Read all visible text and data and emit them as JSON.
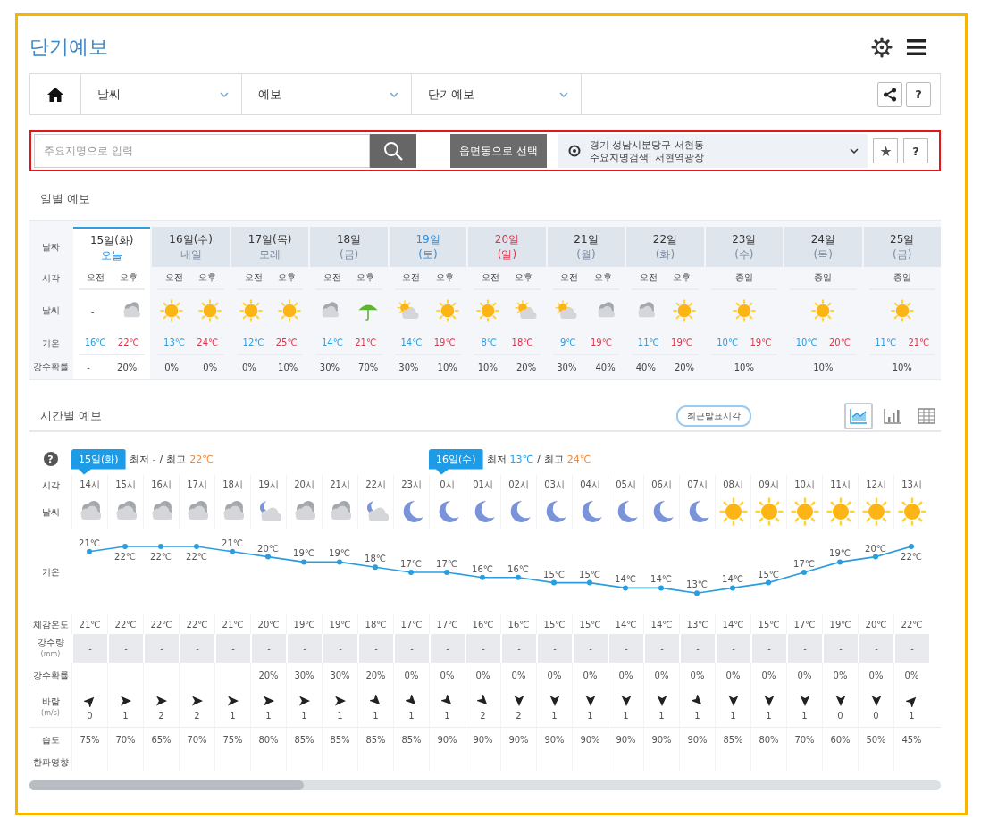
{
  "page": {
    "title": "단기예보"
  },
  "nav": {
    "items": [
      {
        "label": "날씨"
      },
      {
        "label": "예보"
      },
      {
        "label": "단기예보"
      }
    ],
    "help": "?"
  },
  "search": {
    "placeholder": "주요지명으로 입력",
    "region_button": "읍면동으로 선택",
    "location": {
      "address": "경기 성남시분당구 서현동",
      "landmark": "주요지명검색: 서현역광장"
    },
    "help": "?"
  },
  "daily": {
    "title": "일별 예보",
    "row_labels": [
      "날짜",
      "시각",
      "날씨",
      "기온",
      "강수확률"
    ],
    "days": [
      {
        "date": "15일(화)",
        "sub": "오늘",
        "kind": "weekday",
        "selected": true,
        "low": "16℃",
        "high": "22℃",
        "slots": [
          {
            "period": "오전",
            "weather_text": "-",
            "pop": "-"
          },
          {
            "period": "오후",
            "kind": "cloud",
            "pop": "20%"
          }
        ]
      },
      {
        "date": "16일(수)",
        "sub": "내일",
        "kind": "weekday",
        "selected": false,
        "low": "13℃",
        "high": "24℃",
        "slots": [
          {
            "period": "오전",
            "kind": "sun",
            "pop": "0%"
          },
          {
            "period": "오후",
            "kind": "sun",
            "pop": "0%"
          }
        ]
      },
      {
        "date": "17일(목)",
        "sub": "모레",
        "kind": "weekday",
        "selected": false,
        "low": "12℃",
        "high": "25℃",
        "slots": [
          {
            "period": "오전",
            "kind": "sun",
            "pop": "0%"
          },
          {
            "period": "오후",
            "kind": "sun",
            "pop": "10%"
          }
        ]
      },
      {
        "date": "18일",
        "sub": "(금)",
        "kind": "weekday",
        "selected": false,
        "low": "14℃",
        "high": "21℃",
        "slots": [
          {
            "period": "오전",
            "kind": "cloud",
            "pop": "30%"
          },
          {
            "period": "오후",
            "kind": "rain",
            "pop": "70%"
          }
        ]
      },
      {
        "date": "19일",
        "sub": "(토)",
        "kind": "saturday",
        "selected": false,
        "low": "14℃",
        "high": "19℃",
        "slots": [
          {
            "period": "오전",
            "kind": "sun_cloud",
            "pop": "30%"
          },
          {
            "period": "오후",
            "kind": "sun",
            "pop": "10%"
          }
        ]
      },
      {
        "date": "20일",
        "sub": "(일)",
        "kind": "sunday",
        "selected": false,
        "low": "8℃",
        "high": "18℃",
        "slots": [
          {
            "period": "오전",
            "kind": "sun",
            "pop": "10%"
          },
          {
            "period": "오후",
            "kind": "sun_cloud",
            "pop": "20%"
          }
        ]
      },
      {
        "date": "21일",
        "sub": "(월)",
        "kind": "weekday",
        "selected": false,
        "low": "9℃",
        "high": "19℃",
        "slots": [
          {
            "period": "오전",
            "kind": "sun_cloud",
            "pop": "30%"
          },
          {
            "period": "오후",
            "kind": "cloud",
            "pop": "40%"
          }
        ]
      },
      {
        "date": "22일",
        "sub": "(화)",
        "kind": "weekday",
        "selected": false,
        "low": "11℃",
        "high": "19℃",
        "slots": [
          {
            "period": "오전",
            "kind": "cloud",
            "pop": "40%"
          },
          {
            "period": "오후",
            "kind": "sun",
            "pop": "20%"
          }
        ]
      },
      {
        "date": "23일",
        "sub": "(수)",
        "kind": "weekday",
        "selected": false,
        "low": "10℃",
        "high": "19℃",
        "slots": [
          {
            "period": "종일",
            "kind": "sun",
            "pop": "10%"
          }
        ]
      },
      {
        "date": "24일",
        "sub": "(목)",
        "kind": "weekday",
        "selected": false,
        "low": "10℃",
        "high": "20℃",
        "slots": [
          {
            "period": "종일",
            "kind": "sun",
            "pop": "10%"
          }
        ]
      },
      {
        "date": "25일",
        "sub": "(금)",
        "kind": "weekday",
        "selected": false,
        "low": "11℃",
        "high": "21℃",
        "slots": [
          {
            "period": "종일",
            "kind": "sun",
            "pop": "10%"
          }
        ]
      }
    ]
  },
  "hourly": {
    "title": "시간별 예보",
    "issued_button": "최근발표시각",
    "views": [
      {
        "kind": "line",
        "selected": true
      },
      {
        "kind": "bar",
        "selected": false
      },
      {
        "kind": "table",
        "selected": false
      }
    ],
    "help": "?",
    "row_labels": [
      {
        "text": "시각"
      },
      {
        "text": "날씨"
      },
      {
        "text": "기온"
      },
      {
        "text": "체감온도"
      },
      {
        "text": "강수량",
        "unit": "(mm)"
      },
      {
        "text": "강수확률"
      },
      {
        "text": "바람",
        "unit": "(m/s)"
      },
      {
        "text": "습도"
      },
      {
        "text": "한파영향"
      }
    ],
    "columns": [
      {
        "time": "14시",
        "kind": "cloud",
        "temp": "21℃",
        "feels": "21℃",
        "rain": "-",
        "wind": {
          "kind": "ne",
          "speed": "0"
        },
        "humidity": "75%",
        "day_badge": {
          "label": "15일(화)",
          "min_label": "최저",
          "min": "-",
          "separator": "/",
          "max_label": "최고",
          "max": "22℃"
        }
      },
      {
        "time": "15시",
        "kind": "cloud",
        "temp": "22℃",
        "feels": "22℃",
        "rain": "-",
        "wind": {
          "kind": "e",
          "speed": "1"
        },
        "humidity": "70%"
      },
      {
        "time": "16시",
        "kind": "cloud",
        "temp": "22℃",
        "feels": "22℃",
        "rain": "-",
        "wind": {
          "kind": "e",
          "speed": "2"
        },
        "humidity": "65%"
      },
      {
        "time": "17시",
        "kind": "cloud",
        "temp": "22℃",
        "feels": "22℃",
        "rain": "-",
        "wind": {
          "kind": "e",
          "speed": "2"
        },
        "humidity": "70%"
      },
      {
        "time": "18시",
        "kind": "cloud",
        "temp": "21℃",
        "feels": "21℃",
        "rain": "-",
        "wind": {
          "kind": "e",
          "speed": "1"
        },
        "humidity": "75%"
      },
      {
        "time": "19시",
        "kind": "moon_cloud",
        "temp": "20℃",
        "feels": "20℃",
        "rain": "-",
        "pop": "20%",
        "wind": {
          "kind": "e",
          "speed": "1"
        },
        "humidity": "80%"
      },
      {
        "time": "20시",
        "kind": "cloud",
        "temp": "19℃",
        "feels": "19℃",
        "rain": "-",
        "pop": "30%",
        "wind": {
          "kind": "e",
          "speed": "1"
        },
        "humidity": "85%"
      },
      {
        "time": "21시",
        "kind": "cloud",
        "temp": "19℃",
        "feels": "19℃",
        "rain": "-",
        "pop": "30%",
        "wind": {
          "kind": "e",
          "speed": "1"
        },
        "humidity": "85%"
      },
      {
        "time": "22시",
        "kind": "moon_cloud",
        "temp": "18℃",
        "feels": "18℃",
        "rain": "-",
        "pop": "20%",
        "wind": {
          "kind": "se",
          "speed": "1"
        },
        "humidity": "85%"
      },
      {
        "time": "23시",
        "kind": "moon",
        "temp": "17℃",
        "feels": "17℃",
        "rain": "-",
        "pop": "0%",
        "wind": {
          "kind": "se",
          "speed": "1"
        },
        "humidity": "85%"
      },
      {
        "time": "0시",
        "kind": "moon",
        "temp": "17℃",
        "feels": "17℃",
        "rain": "-",
        "pop": "0%",
        "wind": {
          "kind": "se",
          "speed": "1"
        },
        "humidity": "90%",
        "day_badge": {
          "label": "16일(수)",
          "min_label": "최저",
          "min": "13℃",
          "separator": "/",
          "max_label": "최고",
          "max": "24℃"
        }
      },
      {
        "time": "01시",
        "kind": "moon",
        "temp": "16℃",
        "feels": "16℃",
        "rain": "-",
        "pop": "0%",
        "wind": {
          "kind": "se",
          "speed": "2"
        },
        "humidity": "90%"
      },
      {
        "time": "02시",
        "kind": "moon",
        "temp": "16℃",
        "feels": "16℃",
        "rain": "-",
        "pop": "0%",
        "wind": {
          "kind": "s",
          "speed": "2"
        },
        "humidity": "90%"
      },
      {
        "time": "03시",
        "kind": "moon",
        "temp": "15℃",
        "feels": "15℃",
        "rain": "-",
        "pop": "0%",
        "wind": {
          "kind": "s",
          "speed": "1"
        },
        "humidity": "90%"
      },
      {
        "time": "04시",
        "kind": "moon",
        "temp": "15℃",
        "feels": "15℃",
        "rain": "-",
        "pop": "0%",
        "wind": {
          "kind": "s",
          "speed": "1"
        },
        "humidity": "90%"
      },
      {
        "time": "05시",
        "kind": "moon",
        "temp": "14℃",
        "feels": "14℃",
        "rain": "-",
        "pop": "0%",
        "wind": {
          "kind": "s",
          "speed": "1"
        },
        "humidity": "90%"
      },
      {
        "time": "06시",
        "kind": "moon",
        "temp": "14℃",
        "feels": "14℃",
        "rain": "-",
        "pop": "0%",
        "wind": {
          "kind": "s",
          "speed": "1"
        },
        "humidity": "90%"
      },
      {
        "time": "07시",
        "kind": "moon",
        "temp": "13℃",
        "feels": "13℃",
        "rain": "-",
        "pop": "0%",
        "wind": {
          "kind": "se",
          "speed": "1"
        },
        "humidity": "90%"
      },
      {
        "time": "08시",
        "kind": "sun",
        "temp": "14℃",
        "feels": "14℃",
        "rain": "-",
        "pop": "0%",
        "wind": {
          "kind": "s",
          "speed": "1"
        },
        "humidity": "85%"
      },
      {
        "time": "09시",
        "kind": "sun",
        "temp": "15℃",
        "feels": "15℃",
        "rain": "-",
        "pop": "0%",
        "wind": {
          "kind": "s",
          "speed": "1"
        },
        "humidity": "80%"
      },
      {
        "time": "10시",
        "kind": "sun",
        "temp": "17℃",
        "feels": "17℃",
        "rain": "-",
        "pop": "0%",
        "wind": {
          "kind": "s",
          "speed": "1"
        },
        "humidity": "70%"
      },
      {
        "time": "11시",
        "kind": "sun",
        "temp": "19℃",
        "feels": "19℃",
        "rain": "-",
        "pop": "0%",
        "wind": {
          "kind": "s",
          "speed": "0"
        },
        "humidity": "60%"
      },
      {
        "time": "12시",
        "kind": "sun",
        "temp": "20℃",
        "feels": "20℃",
        "rain": "-",
        "pop": "0%",
        "wind": {
          "kind": "s",
          "speed": "0"
        },
        "humidity": "50%"
      },
      {
        "time": "13시",
        "kind": "sun",
        "temp": "22℃",
        "feels": "22℃",
        "rain": "-",
        "pop": "0%",
        "wind": {
          "kind": "ne",
          "speed": "1"
        },
        "humidity": "45%"
      }
    ]
  }
}
